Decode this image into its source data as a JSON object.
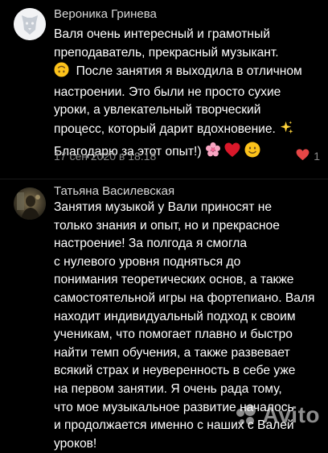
{
  "comments": [
    {
      "author": "Вероника Гринева",
      "lines": [
        "Валя очень интересный и грамотный",
        "преподаватель, прекрасный музыкант.",
        "После занятия я выходила в отличном",
        "настроении. Это были не просто сухие",
        "уроки, а увлекательный творческий",
        "процесс, который дарит вдохновение.",
        "Благодарю за этот опыт!)"
      ],
      "timestamp": "17 сен 2020 в 18:18",
      "likes": "1"
    },
    {
      "author": "Татьяна Василевская",
      "lines": [
        "Занятия музыкой у Вали приносят не",
        "только знания и опыт, но и прекрасное",
        "настроение! За полгода я смогла",
        "с нулевого уровня подняться до",
        "понимания теоретических основ, а также",
        "самостоятельной игры на фортепиано. Валя",
        "находит индивидуальный подход к своим",
        "ученикам, что помогает плавно и быстро",
        "найти темп обучения, а также развевает",
        "всякий страх и неуверенность в себе уже",
        "на первом занятии. Я очень рада тому,",
        "что мое музыкальное развитие началось",
        "и продолжается именно с наших с Валей",
        "уроков!"
      ]
    }
  ],
  "icons": {
    "avatar1": "vk-dog-avatar-icon",
    "avatar2": "user-photo-avatar",
    "heart": "heart-icon",
    "emoji_upside": "upside-down-face-icon",
    "emoji_sparkles": "sparkles-icon",
    "emoji_blossom": "cherry-blossom-icon",
    "emoji_heart": "red-heart-icon",
    "emoji_smile": "smiling-face-icon"
  },
  "colors": {
    "background": "#000000",
    "text": "#ffffff",
    "author": "#d9d9d9",
    "meta": "#8a8a8a",
    "like_heart": "#e64646"
  },
  "watermark": "Avito"
}
